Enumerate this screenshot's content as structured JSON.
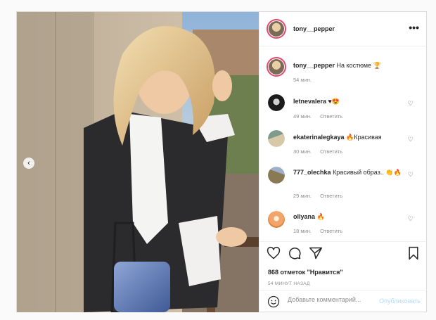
{
  "post": {
    "username": "tony__pepper",
    "more_label": "•••",
    "caption": {
      "username": "tony__pepper",
      "text": "На костюме 🏆",
      "time": "54 мин."
    },
    "comments": [
      {
        "username": "letnevalera",
        "text": "♥😍",
        "time": "49 мин.",
        "reply": "Ответить"
      },
      {
        "username": "ekaterinalegkaya",
        "text": "🔥Красивая",
        "time": "30 мин.",
        "reply": "Ответить"
      },
      {
        "username": "777_olechka",
        "text": "Красивый образ.. 👏🔥",
        "time": "29 мин.",
        "reply": "Ответить"
      },
      {
        "username": "ollyana",
        "text": "🔥",
        "time": "18 мин.",
        "reply": "Ответить"
      }
    ],
    "likes": "868 отметок \"Нравится\"",
    "posted_ago": "54 минут назад",
    "add_comment_placeholder": "Добавьте комментарий...",
    "publish_label": "Опубликовать",
    "prev_arrow": "‹"
  },
  "icons": {
    "more": "more-icon",
    "like": "heart-icon",
    "comment": "comment-icon",
    "share": "share-icon",
    "save": "bookmark-icon",
    "emoji": "emoji-icon",
    "comment_like": "small-heart-icon"
  },
  "colors": {
    "story_ring": "#e34b6e",
    "publish_disabled": "#b3dbff",
    "meta_gray": "#8e8e8e"
  }
}
